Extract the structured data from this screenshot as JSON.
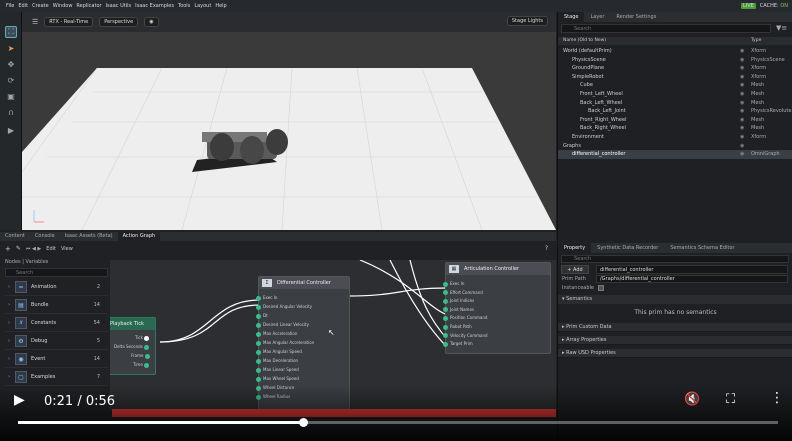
{
  "menu": [
    "File",
    "Edit",
    "Create",
    "Window",
    "Replicator",
    "Isaac Utils",
    "Isaac Examples",
    "Tools",
    "Layout",
    "Help"
  ],
  "live": "LIVE",
  "cache_label": "CACHE:",
  "cache_status": "ON",
  "viewport": {
    "rtx": "RTX - Real-Time",
    "perspective": "Perspective",
    "stage_lights": "Stage Lights"
  },
  "stage": {
    "tabs": [
      "Stage",
      "Layer",
      "Render Settings"
    ],
    "search_placeholder": "Search",
    "col_name": "Name (Old to New)",
    "col_type": "Type",
    "rows": [
      {
        "name": "World (defaultPrim)",
        "type": "Xform"
      },
      {
        "name": "PhysicsScene",
        "type": "PhysicsScene"
      },
      {
        "name": "GroundPlane",
        "type": "Xform"
      },
      {
        "name": "SimpleRobot",
        "type": "Xform"
      },
      {
        "name": "Cube",
        "type": "Mesh"
      },
      {
        "name": "Front_Left_Wheel",
        "type": "Mesh"
      },
      {
        "name": "Back_Left_Wheel",
        "type": "Mesh"
      },
      {
        "name": "Back_Left_Joint",
        "type": "PhysicsRevolute..."
      },
      {
        "name": "Front_Right_Wheel",
        "type": "Mesh"
      },
      {
        "name": "Back_Right_Wheel",
        "type": "Mesh"
      },
      {
        "name": "Environment",
        "type": "Xform"
      },
      {
        "name": "Graphs",
        "type": ""
      },
      {
        "name": "differential_controller",
        "type": "OmniGraph"
      }
    ]
  },
  "property": {
    "tabs": [
      "Property",
      "Synthetic Data Recorder",
      "Semantics Schema Editor"
    ],
    "search_placeholder": "Search",
    "add": "Add",
    "prim_name": "differential_controller",
    "prim_path_label": "Prim Path",
    "prim_path": "/Graphs/differential_controller",
    "instanceable_label": "Instanceable",
    "semantics": "Semantics",
    "no_semantics": "This prim has no semantics",
    "sections": [
      "Prim Custom Data",
      "Array Properties",
      "Raw USD Properties"
    ]
  },
  "bottom": {
    "tabs": [
      "Content",
      "Console",
      "Isaac Assets (Beta)",
      "Action Graph"
    ],
    "edit": "Edit",
    "view": "View",
    "nodes_label": "Nodes",
    "variables_label": "Variables",
    "search_placeholder": "Search",
    "graph_name": "differential_controller",
    "categories": [
      {
        "name": "Animation",
        "count": "2"
      },
      {
        "name": "Bundle",
        "count": "14"
      },
      {
        "name": "Constants",
        "count": "54"
      },
      {
        "name": "Debug",
        "count": "5"
      },
      {
        "name": "Event",
        "count": "14"
      },
      {
        "name": "Examples",
        "count": "7"
      }
    ]
  },
  "nodes": {
    "playback": {
      "title": "Playback Tick",
      "ports": [
        "Tick",
        "Delta Seconds",
        "Frame",
        "Time"
      ]
    },
    "diff": {
      "title": "Differential Controller",
      "ports": [
        "Exec In",
        "Desired Angular Velocity",
        "Dt",
        "Desired Linear Velocity",
        "Max Acceleration",
        "Max Angular Acceleration",
        "Max Angular Speed",
        "Max Deceleration",
        "Max Linear Speed",
        "Max Wheel Speed",
        "Wheel Distance",
        "Wheel Radius"
      ]
    },
    "artic": {
      "title": "Articulation Controller",
      "ports": [
        "Exec In",
        "Effort Command",
        "Joint Indices",
        "Joint Names",
        "Position Command",
        "Robot Path",
        "Velocity Command",
        "Target Prim"
      ]
    }
  },
  "video": {
    "current": "0:21",
    "duration": "0:56",
    "played": 0.375
  }
}
